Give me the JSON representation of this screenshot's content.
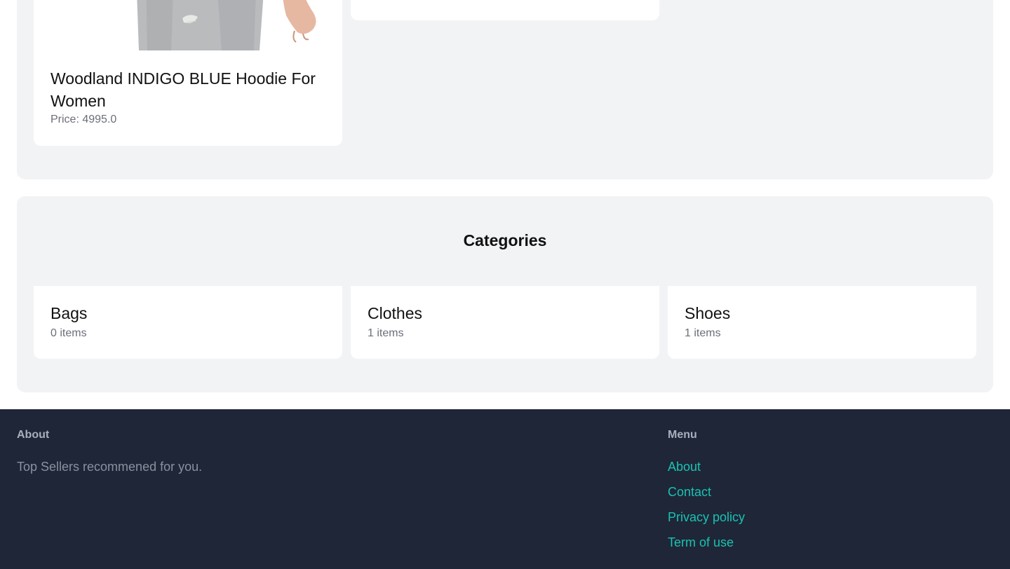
{
  "products": [
    {
      "title": "Woodland INDIGO BLUE Hoodie For Women",
      "price": "Price: 4995.0"
    }
  ],
  "categories": {
    "title": "Categories",
    "items": [
      {
        "name": "Bags",
        "count": "0 items"
      },
      {
        "name": "Clothes",
        "count": "1 items"
      },
      {
        "name": "Shoes",
        "count": "1 items"
      }
    ]
  },
  "footer": {
    "about_heading": "About",
    "about_text": "Top Sellers recommened for you.",
    "menu_heading": "Menu",
    "menu_items": [
      {
        "label": "About"
      },
      {
        "label": "Contact"
      },
      {
        "label": "Privacy policy"
      },
      {
        "label": "Term of use"
      }
    ],
    "link_color": "#19c3b1",
    "background_color": "#1f2638"
  }
}
